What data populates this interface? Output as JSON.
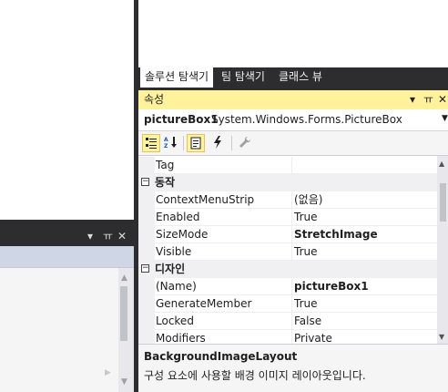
{
  "left_panel": {
    "controls": {
      "dropdown": "▾",
      "pin": "ㅠ",
      "close": "✕"
    }
  },
  "tool_tabs": [
    {
      "label": "솔루션 탐색기",
      "active": true
    },
    {
      "label": "팀 탐색기",
      "active": false
    },
    {
      "label": "클래스 뷰",
      "active": false
    }
  ],
  "properties": {
    "title": "속성",
    "controls": {
      "dropdown": "▾",
      "pin": "ㅠ",
      "close": "✕"
    },
    "object_name": "pictureBox1",
    "object_type": "System.Windows.Forms.PictureBox",
    "toolbar": {
      "categorized_icon": "categorized-icon",
      "alphabetical_icon": "alphabetical-icon",
      "properties_icon": "properties-icon",
      "events_icon": "lightning-icon",
      "property_pages_icon": "wrench-icon"
    },
    "grid": {
      "rows": [
        {
          "kind": "prop",
          "name": "Tag",
          "value": "",
          "bold": false
        },
        {
          "kind": "cat",
          "name": "동작",
          "toggle": "−"
        },
        {
          "kind": "prop",
          "name": "ContextMenuStrip",
          "value": "(없음)",
          "bold": false
        },
        {
          "kind": "prop",
          "name": "Enabled",
          "value": "True",
          "bold": false
        },
        {
          "kind": "prop",
          "name": "SizeMode",
          "value": "StretchImage",
          "bold": true
        },
        {
          "kind": "prop",
          "name": "Visible",
          "value": "True",
          "bold": false
        },
        {
          "kind": "cat",
          "name": "디자인",
          "toggle": "−"
        },
        {
          "kind": "prop",
          "name": "(Name)",
          "value": "pictureBox1",
          "bold": true
        },
        {
          "kind": "prop",
          "name": "GenerateMember",
          "value": "True",
          "bold": false
        },
        {
          "kind": "prop",
          "name": "Locked",
          "value": "False",
          "bold": false
        },
        {
          "kind": "prop",
          "name": "Modifiers",
          "value": "Private",
          "bold": false
        }
      ]
    },
    "description": {
      "title": "BackgroundImageLayout",
      "text": "구성 요소에 사용할 배경 이미지 레이아웃입니다."
    }
  },
  "colors": {
    "chrome": "#2d2d30",
    "active_title": "#fff29d",
    "panel": "#f5f5f5"
  }
}
